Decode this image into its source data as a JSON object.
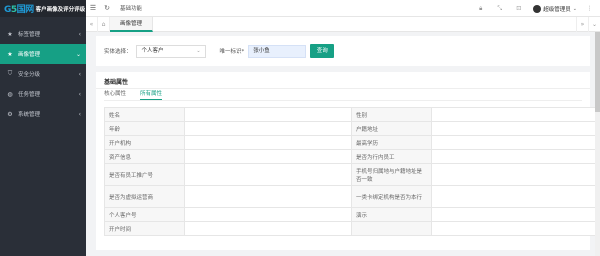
{
  "brand": {
    "logo_main": "G",
    "logo_accent": "5",
    "logo_text": "国网",
    "title": "客户画像及评分评级"
  },
  "sidebar": {
    "items": [
      {
        "label": "标签管理",
        "icon": "star-icon",
        "glyph": "★"
      },
      {
        "label": "画像管理",
        "icon": "star-icon",
        "glyph": "★"
      },
      {
        "label": "安全分级",
        "icon": "shield-icon",
        "glyph": "⛉"
      },
      {
        "label": "任务管理",
        "icon": "globe-icon",
        "glyph": "◍"
      },
      {
        "label": "系统管理",
        "icon": "gear-icon",
        "glyph": "⚙"
      }
    ],
    "active_index": 1
  },
  "topbar": {
    "menu_icon": "menu-icon",
    "refresh_icon": "refresh-icon",
    "link": "基础功能",
    "user": "超级管理员"
  },
  "tabs": {
    "items": [
      "画像管理"
    ]
  },
  "search": {
    "entity_label": "实体选择：",
    "entity_value": "个人客户",
    "id_label": "唯一标识*",
    "id_value": "张小鱼",
    "button": "查询"
  },
  "detail": {
    "title": "基础属性",
    "sub_tabs": [
      "核心属性",
      "所有属性"
    ],
    "active_sub_tab": 1,
    "rows": [
      {
        "k1": "姓名",
        "v1": "",
        "k2": "性别",
        "v2": ""
      },
      {
        "k1": "年龄",
        "v1": "",
        "k2": "户籍地址",
        "v2": ""
      },
      {
        "k1": "开户机构",
        "v1": "",
        "k2": "最高学历",
        "v2": ""
      },
      {
        "k1": "资产信息",
        "v1": "",
        "k2": "是否为行内员工",
        "v2": ""
      },
      {
        "k1": "是否有员工推广号",
        "v1": "",
        "k2": "手机号归属地与户籍地址是否一致",
        "v2": ""
      },
      {
        "k1": "是否为虚拟运营商",
        "v1": "",
        "k2": "一类卡绑定机构是否为本行",
        "v2": ""
      },
      {
        "k1": "个人客户号",
        "v1": "",
        "k2": "演示",
        "v2": ""
      },
      {
        "k1": "开户时间",
        "v1": "",
        "k2": "",
        "v2": ""
      }
    ]
  }
}
